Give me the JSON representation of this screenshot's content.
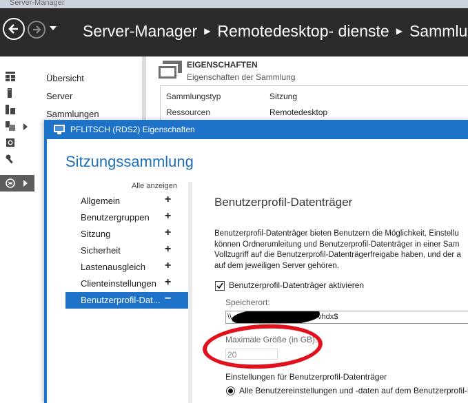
{
  "window": {
    "title": "Server-Manager"
  },
  "header": {
    "breadcrumbs": [
      "Server-Manager",
      "Remotedesktop- dienste",
      "Sammlun"
    ]
  },
  "sidebar_nav": [
    "Übersicht",
    "Server",
    "Sammlungen"
  ],
  "properties": {
    "title": "EIGENSCHAFTEN",
    "subtitle": "Eigenschaften der Sammlung",
    "rows": [
      {
        "label": "Sammlungstyp",
        "value": "Sitzung"
      },
      {
        "label": "Ressourcen",
        "value": "Remotedesktop"
      }
    ]
  },
  "dialog": {
    "title": "PFLITSCH (RDS2) Eigenschaften",
    "heading": "Sitzungssammlung",
    "show_all": "Alle anzeigen",
    "nav": [
      {
        "label": "Allgemein",
        "toggle": "+"
      },
      {
        "label": "Benutzergruppen",
        "toggle": "+"
      },
      {
        "label": "Sitzung",
        "toggle": "+"
      },
      {
        "label": "Sicherheit",
        "toggle": "+"
      },
      {
        "label": "Lastenausgleich",
        "toggle": "+"
      },
      {
        "label": "Clienteinstellungen",
        "toggle": "+"
      },
      {
        "label": "Benutzerprofil-Dat...",
        "toggle": "−",
        "selected": true
      }
    ],
    "content": {
      "title": "Benutzerprofil-Datenträger",
      "description": [
        "Benutzerprofil-Datenträger bieten Benutzern die Möglichkeit, Einstellu",
        "können Ordnerumleitung und Benutzerprofil-Datenträger in einer Sam",
        "Vollzugriff auf die Benutzerprofil-Datenträgerfreigabe haben, und der a",
        "auf dem jeweiligen Server gehören."
      ],
      "enable_label": "Benutzerprofil-Datenträger aktivieren",
      "enable_checked": true,
      "location_label": "Speicherort:",
      "location_prefix": "\\\\",
      "location_suffix": "vhdx$",
      "max_size_label": "Maximale Größe (in GB):",
      "max_size_value": "20",
      "settings_label": "Einstellungen für Benutzerprofil-Datenträger",
      "radio_label": "Alle Benutzereinstellungen und -daten auf dem Benutzerprofil-D"
    }
  },
  "colors": {
    "accent": "#1e72c8",
    "header_bg": "#2b2b2b",
    "annotation": "#e0101c"
  }
}
